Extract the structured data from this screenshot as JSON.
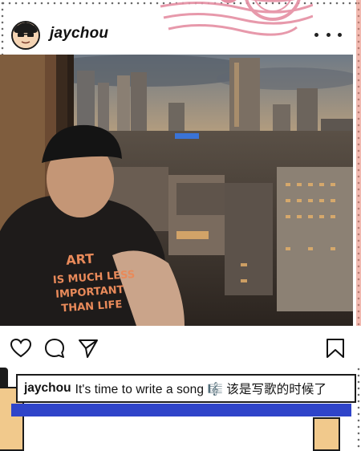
{
  "post": {
    "username": "jaychou",
    "caption_username": "jaychou",
    "caption_text": "It's time to write a song 🎼 该是写歌的时候了",
    "shirt_text": [
      "ART",
      "IS MUCH LESS",
      "IMPORTANT",
      "THAN LIFE"
    ]
  },
  "icons": {
    "like": "heart-icon",
    "comment": "comment-icon",
    "share": "send-icon",
    "save": "bookmark-icon",
    "more": "more-options-icon"
  },
  "colors": {
    "accent_blue": "#2f44c9",
    "accent_yellow": "#f1c98c",
    "stamp_pink": "#e58fa3"
  }
}
